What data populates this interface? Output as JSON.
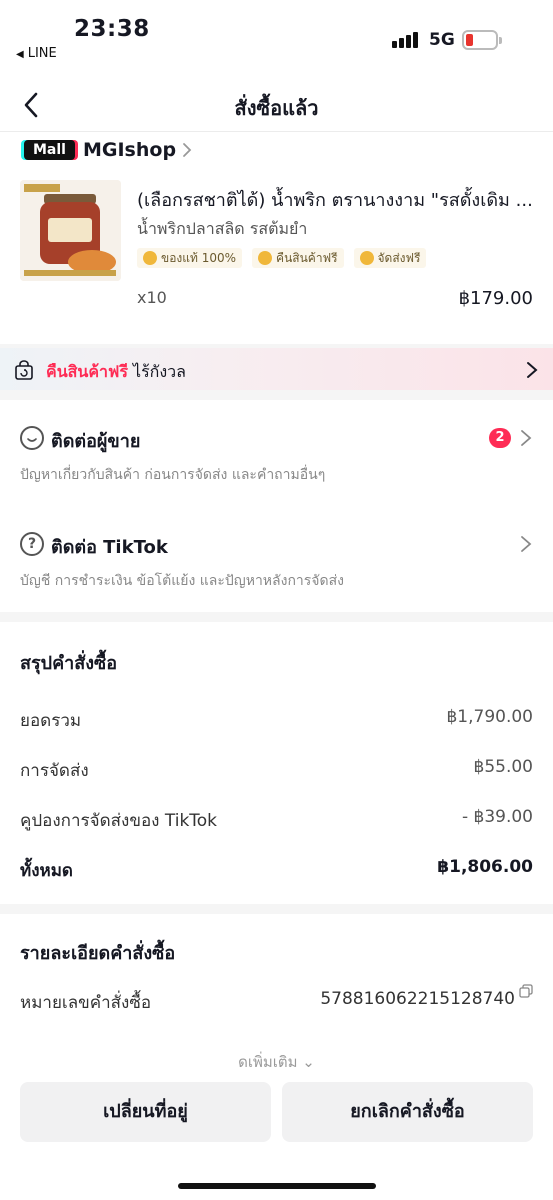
{
  "status_bar": {
    "time": "23:38",
    "back_app": "LINE",
    "network": "5G"
  },
  "nav": {
    "title": "สั่งซื้อแล้ว"
  },
  "shop": {
    "badge": "Mall",
    "name": "MGIshop"
  },
  "product": {
    "title": "(เลือกรสชาติได้) น้ำพริก ตรานางงาม \"รสดั้งเดิม ...",
    "variant": "น้ำพริกปลาสลิด รสต้มยำ",
    "badges": [
      "ของแท้ 100%",
      "คืนสินค้าฟรี",
      "จัดส่งฟรี"
    ],
    "quantity": "x10",
    "price": "฿179.00"
  },
  "promo": {
    "highlight": "คืนสินค้าฟรี",
    "text": " ไร้กังวล"
  },
  "contacts": [
    {
      "title": "ติดต่อผู้ขาย",
      "description": "ปัญหาเกี่ยวกับสินค้า ก่อนการจัดส่ง และคำถามอื่นๆ",
      "badge": "2"
    },
    {
      "title": "ติดต่อ TikTok",
      "description": "บัญชี การชำระเงิน ข้อโต้แย้ง และปัญหาหลังการจัดส่ง"
    }
  ],
  "summary": {
    "title": "สรุปคำสั่งซื้อ",
    "rows": [
      {
        "label": "ยอดรวม",
        "value": "฿1,790.00"
      },
      {
        "label": "การจัดส่ง",
        "value": "฿55.00"
      },
      {
        "label": "คูปองการจัดส่งของ TikTok",
        "value": "- ฿39.00"
      },
      {
        "label": "ทั้งหมด",
        "value": "฿1,806.00"
      }
    ]
  },
  "details": {
    "title": "รายละเอียดคำสั่งซื้อ",
    "order_id_label": "หมายเลขคำสั่งซื้อ",
    "order_id": "578816062215128740",
    "more_label": "ดเพิ่มเติม"
  },
  "actions": {
    "change_address": "เปลี่ยนที่อยู่",
    "cancel_order": "ยกเลิกคำสั่งซื้อ"
  },
  "colors": {
    "accent": "#fe2c55",
    "badge_bg": "#fbf6ea",
    "button_bg": "#f1f1f2"
  }
}
